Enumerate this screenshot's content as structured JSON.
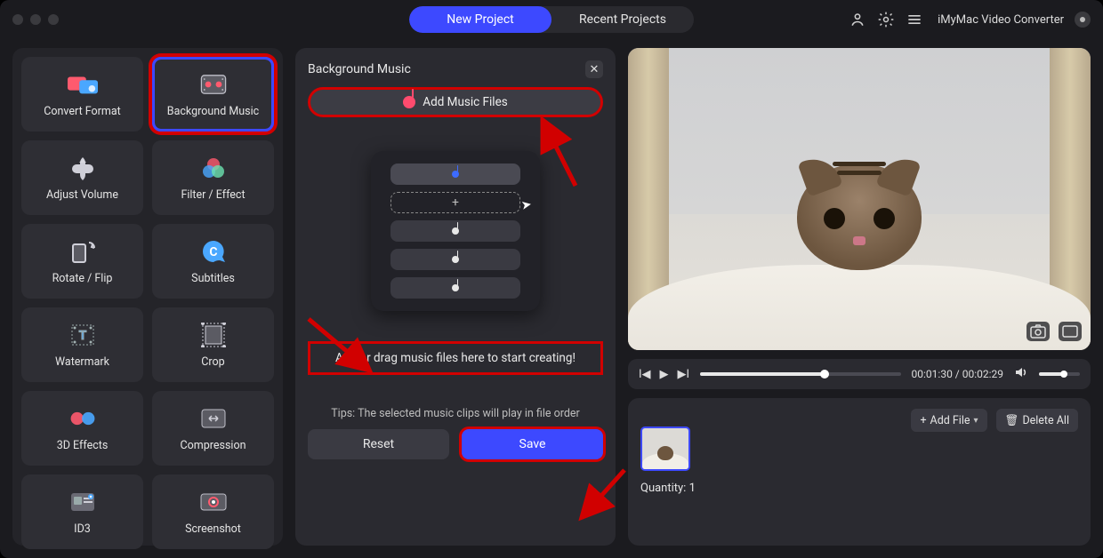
{
  "titlebar": {
    "app_name": "iMyMac Video Converter",
    "tabs": {
      "new_project": "New Project",
      "recent_projects": "Recent Projects"
    }
  },
  "tools": {
    "convert_format": "Convert Format",
    "background_music": "Background Music",
    "adjust_volume": "Adjust Volume",
    "filter_effect": "Filter / Effect",
    "rotate_flip": "Rotate / Flip",
    "subtitles": "Subtitles",
    "watermark": "Watermark",
    "crop": "Crop",
    "threed_effects": "3D Effects",
    "compression": "Compression",
    "id3": "ID3",
    "screenshot": "Screenshot"
  },
  "panel": {
    "title": "Background Music",
    "add_button": "Add Music Files",
    "hint": "Add or drag music files here to start creating!",
    "tips": "Tips: The selected music clips will play in file order",
    "reset": "Reset",
    "save": "Save"
  },
  "player": {
    "time_current": "00:01:30",
    "time_total": "00:02:29",
    "progress_pct": 62,
    "volume_pct": 60
  },
  "filelist": {
    "add_file": "Add File",
    "delete_all": "Delete All",
    "quantity_label": "Quantity:",
    "quantity_value": "1"
  }
}
